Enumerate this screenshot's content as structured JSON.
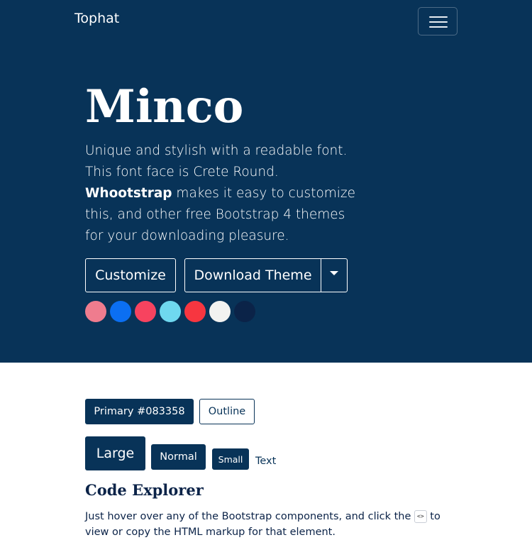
{
  "navbar": {
    "brand": "Tophat",
    "toggler_icon": "hamburger-icon"
  },
  "hero": {
    "title": "Minco",
    "lead_part1": "Unique and stylish with a readable font. This font face is Crete Round. ",
    "lead_strong": "Whootstrap",
    "lead_part2": " makes it easy to customize this, and other free Bootstrap 4 themes for your downloading pleasure.",
    "customize_label": "Customize",
    "download_label": "Download Theme",
    "caret_icon": "caret-down-icon"
  },
  "swatches": [
    "#ef7c8e",
    "#0b6ff2",
    "#f7435f",
    "#6fd8ef",
    "#f73640",
    "#f2f2f0",
    "#0b2348"
  ],
  "buttons": {
    "primary_label": "Primary #083358",
    "outline_label": "Outline",
    "large_label": "Large",
    "normal_label": "Normal",
    "small_label": "Small",
    "text_label": "Text"
  },
  "code_explorer": {
    "title": "Code Explorer",
    "desc_before": "Just hover over any of the Bootstrap components, and click the ",
    "code_chip": "<>",
    "desc_after": " to view or copy the HTML markup for that element."
  },
  "colors": {
    "primary": "#083358",
    "white": "#ffffff"
  }
}
